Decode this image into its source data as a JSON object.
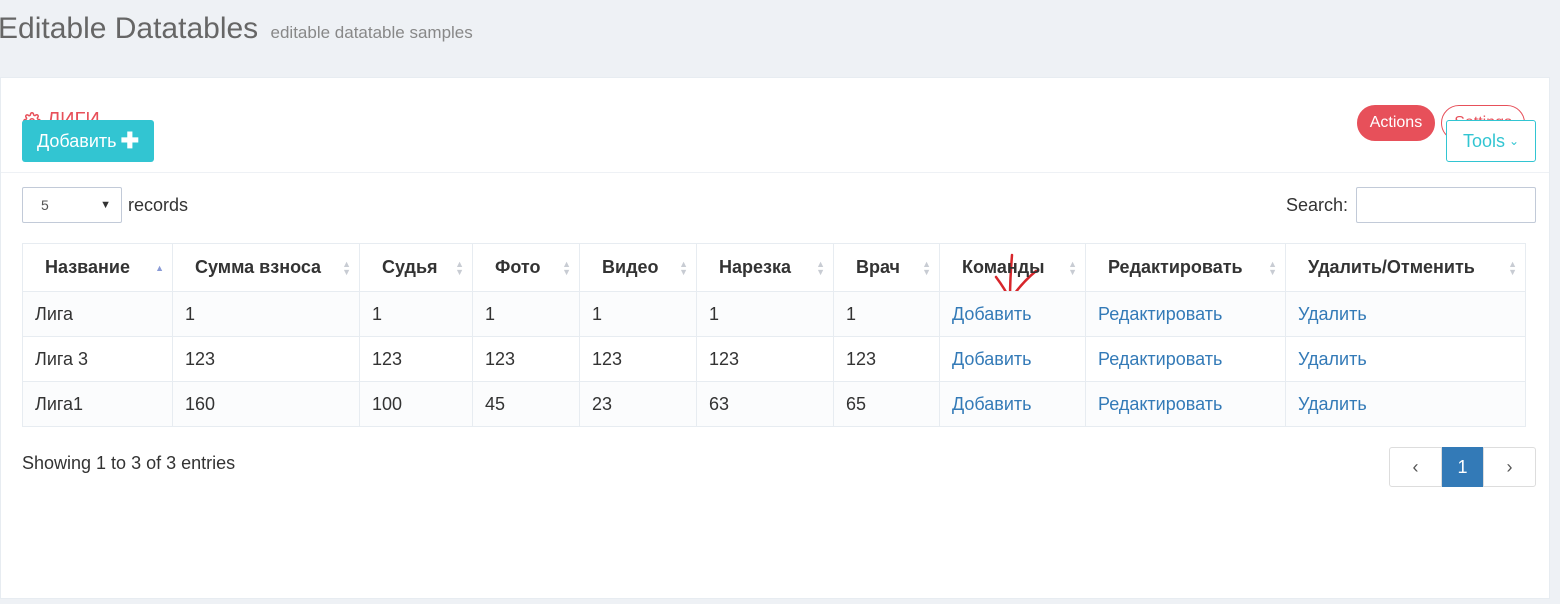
{
  "page": {
    "title": "Editable Datatables",
    "subtitle": "editable datatable samples"
  },
  "portlet": {
    "caption": "ЛИГИ",
    "actions_label": "Actions",
    "settings_label": "Settings",
    "add_label": "Добавить",
    "tools_label": "Tools"
  },
  "length": {
    "value": "5",
    "suffix": "records"
  },
  "search": {
    "label": "Search:",
    "value": ""
  },
  "table": {
    "columns": [
      "Название",
      "Сумма взноса",
      "Судья",
      "Фото",
      "Видео",
      "Нарезка",
      "Врач",
      "Команды",
      "Редактировать",
      "Удалить/Отменить"
    ],
    "sorted_column": "Название",
    "rows": [
      {
        "name": "Лига",
        "fee": "1",
        "judge": "1",
        "photo": "1",
        "video": "1",
        "cut": "1",
        "doctor": "1",
        "teams": "Добавить",
        "edit": "Редактировать",
        "delete": "Удалить"
      },
      {
        "name": "Лига 3",
        "fee": "123",
        "judge": "123",
        "photo": "123",
        "video": "123",
        "cut": "123",
        "doctor": "123",
        "teams": "Добавить",
        "edit": "Редактировать",
        "delete": "Удалить"
      },
      {
        "name": "Лига1",
        "fee": "160",
        "judge": "100",
        "photo": "45",
        "video": "23",
        "cut": "63",
        "doctor": "65",
        "teams": "Добавить",
        "edit": "Редактировать",
        "delete": "Удалить"
      }
    ]
  },
  "footer": {
    "info": "Showing 1 to 3 of 3 entries",
    "prev": "‹",
    "current_page": "1",
    "next": "›"
  },
  "icons": {
    "caption_icon": "gear-icon",
    "add_icon": "plus-icon",
    "tools_icon": "chevron-down-icon",
    "annotation": "red-arrow-down-icon"
  },
  "colors": {
    "accent_red": "#e7505a",
    "accent_cyan": "#32c5d2",
    "link_blue": "#337ab7"
  }
}
